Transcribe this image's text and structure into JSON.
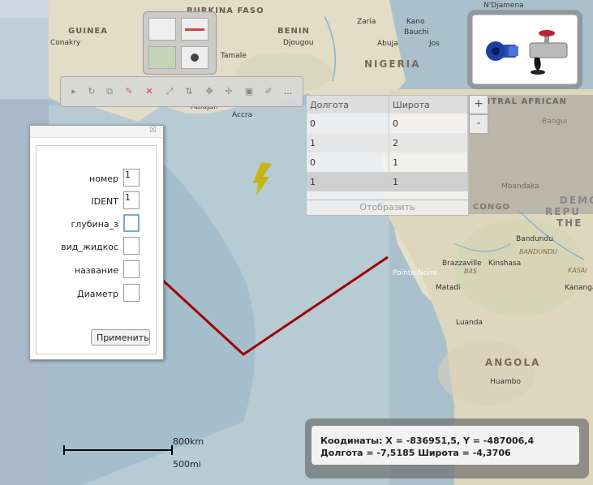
{
  "map": {
    "labels": {
      "burkina_faso": "BURKINA FASO",
      "ndjamena": "N'Djamena",
      "guinea": "GUINEA",
      "conakry": "Conakry",
      "benin": "BENIN",
      "djougou": "Djougou",
      "nigeria": "NIGERIA",
      "kano": "Kano",
      "zaria": "Zaria",
      "bauchi": "Bauchi",
      "tamale": "Tamale",
      "abuja": "Abuja",
      "jos": "Jos",
      "abidjan": "Abidjan",
      "accra": "Accra",
      "central_african": "NTRAL AFRICAN",
      "bangui": "Bangui",
      "mbandaka": "Mbandaka",
      "congo": "CONGO",
      "demo": "DEMO",
      "repu": "REPU",
      "the": "THE",
      "bandundu_city": "Bandundu",
      "bandundu_region": "BANDUNDU",
      "brazzaville": "Brazzaville",
      "kinshasa": "Kinshasa",
      "pointe_noire": "Pointe-Noire",
      "matadi": "Matadi",
      "kasai": "KASAI",
      "kananga": "Kananga",
      "luanda": "Luanda",
      "angola": "ANGOLA",
      "huambo": "Huambo",
      "bas": "BAS"
    }
  },
  "style_panel": {
    "swatches": [
      "polygon-empty",
      "line-red",
      "polygon-green",
      "point"
    ]
  },
  "toolbar": {
    "tools": [
      "arrow-icon",
      "rotate-icon",
      "copy-icon",
      "erase-icon",
      "close-icon",
      "resize-icon",
      "align-icon",
      "gear-icon",
      "move-icon",
      "save-icon",
      "edit-icon"
    ],
    "more": "..."
  },
  "tools_panel": {
    "icons": [
      "valve-icon",
      "pipe-leak-icon"
    ]
  },
  "coords_grid": {
    "columns": [
      "Долгота",
      "Широта"
    ],
    "rows": [
      [
        "0",
        "0"
      ],
      [
        "1",
        "2"
      ],
      [
        "0",
        "1"
      ],
      [
        "1",
        "1"
      ]
    ],
    "button": "Отобразить"
  },
  "zoom": {
    "in": "+",
    "out": "-"
  },
  "form": {
    "fields": [
      {
        "label": "номер",
        "value": "1"
      },
      {
        "label": "IDENT",
        "value": "1"
      },
      {
        "label": "глубина_з",
        "value": ""
      },
      {
        "label": "вид_жидкос",
        "value": ""
      },
      {
        "label": "название",
        "value": ""
      },
      {
        "label": "Диаметр",
        "value": ""
      }
    ],
    "apply": "Применить",
    "close": "☒"
  },
  "scale": {
    "km": "800km",
    "mi": "500mi"
  },
  "status": {
    "line1": "Кoодинаты: X = -836951,5, Y = -487006,4",
    "line2": "Долгота = -7,5185 Широта = -4,3706"
  },
  "colors": {
    "ocean": "#b9ccd5",
    "land": "#e7e2d3",
    "route": "#a00000",
    "marker": "#c8b400"
  }
}
